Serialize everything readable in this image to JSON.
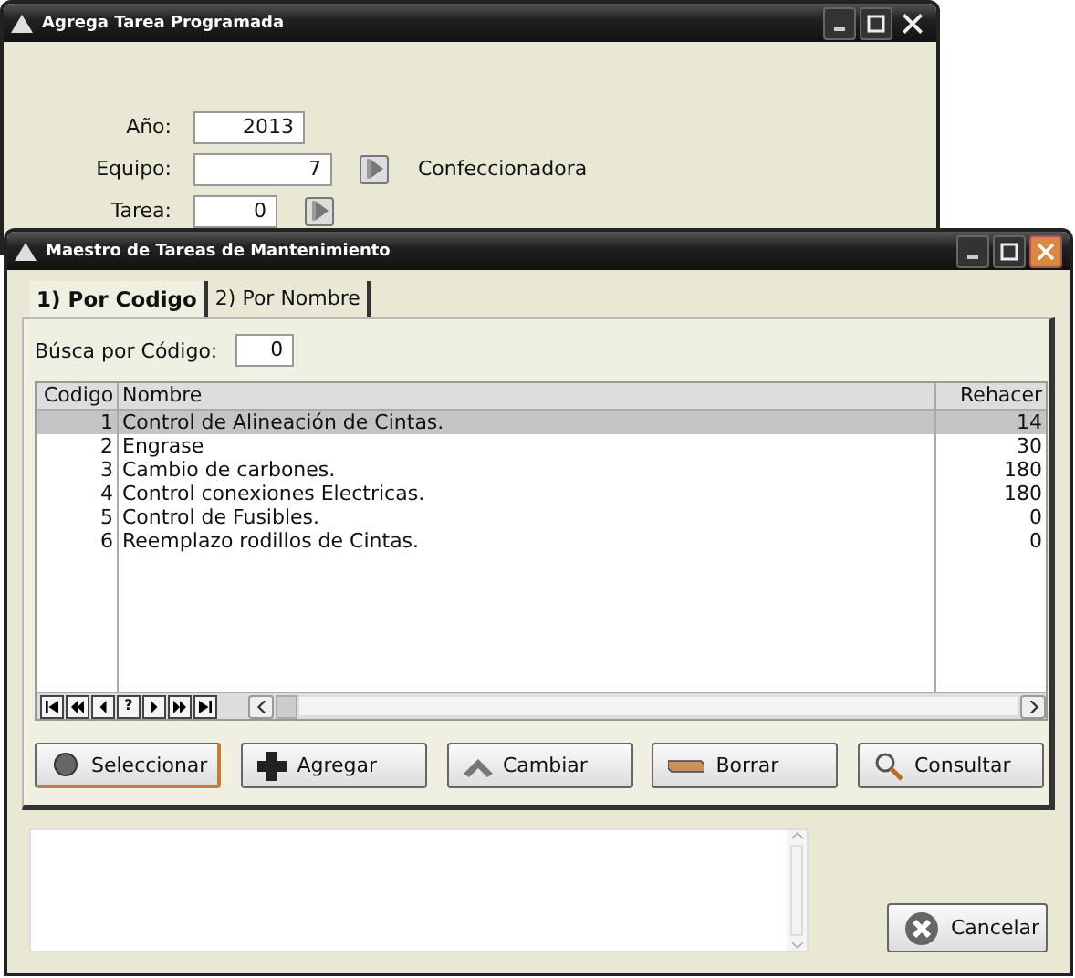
{
  "back_window": {
    "title": "Agrega Tarea Programada",
    "fields": [
      {
        "label": "Año:",
        "value": "2013",
        "lookup": false
      },
      {
        "label": "Equipo:",
        "value": "7",
        "lookup": true,
        "lookup_text": "Confeccionadora"
      },
      {
        "label": "Tarea:",
        "value": "0",
        "lookup": true
      }
    ]
  },
  "front_window": {
    "title": "Maestro de Tareas de Mantenimiento",
    "tabs": [
      {
        "label": "1) Por Codigo",
        "selected": true
      },
      {
        "label": "2) Por Nombre",
        "selected": false
      }
    ],
    "search": {
      "label": "Búsca por Código:",
      "value": "0"
    },
    "table": {
      "columns": [
        "Codigo",
        "Nombre",
        "Rehacer"
      ],
      "rows": [
        {
          "cells": [
            "1",
            "Control de Alineación de Cintas.",
            "14"
          ],
          "selected": true
        },
        {
          "cells": [
            "2",
            "Engrase",
            "30"
          ],
          "selected": false
        },
        {
          "cells": [
            "3",
            "Cambio de carbones.",
            "180"
          ],
          "selected": false
        },
        {
          "cells": [
            "4",
            "Control conexiones Electricas.",
            "180"
          ],
          "selected": false
        },
        {
          "cells": [
            "5",
            "Control de Fusibles.",
            "0"
          ],
          "selected": false
        },
        {
          "cells": [
            "6",
            "Reemplazo rodillos de Cintas.",
            "0"
          ],
          "selected": false
        }
      ]
    },
    "navigator": {
      "help_label": "?"
    },
    "buttons": [
      {
        "label": "Seleccionar",
        "kind": "select",
        "focused": true
      },
      {
        "label": "Agregar",
        "kind": "add",
        "focused": false
      },
      {
        "label": "Cambiar",
        "kind": "change",
        "focused": false
      },
      {
        "label": "Borrar",
        "kind": "delete",
        "focused": false
      },
      {
        "label": "Consultar",
        "kind": "query",
        "focused": false
      }
    ],
    "cancel_button": {
      "label": "Cancelar"
    }
  }
}
